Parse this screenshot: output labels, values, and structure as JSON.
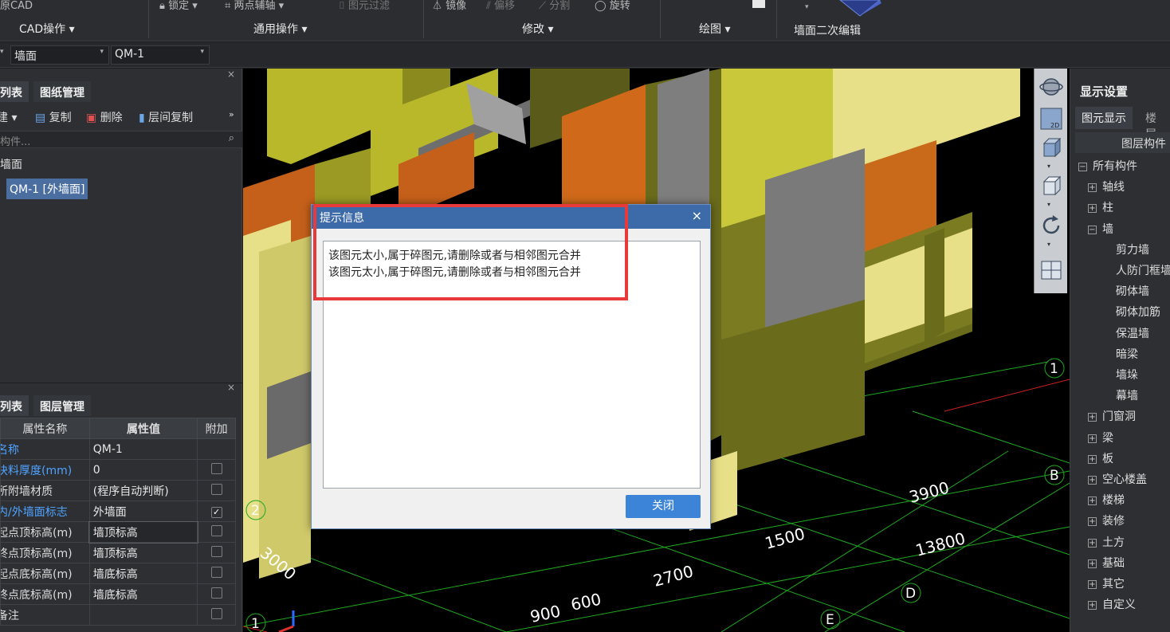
{
  "ribbon": {
    "app_fragment": "原CAD",
    "top_items": {
      "lock": "锁定",
      "two_point_axis": "两点辅轴",
      "filter": "图元过滤",
      "mirror": "镜像",
      "offset": "偏移",
      "split": "分割",
      "rotate": "旋转"
    },
    "groups": {
      "cad_ops": "CAD操作",
      "general_ops": "通用操作",
      "modify": "修改",
      "draw": "绘图",
      "wall_secondary_edit": "墙面二次编辑"
    }
  },
  "selectors": {
    "category": "墙面",
    "component": "QM-1"
  },
  "left_top_panel": {
    "tabs": {
      "list": "列表",
      "drawing_mgmt": "图纸管理"
    },
    "toolbar": {
      "new": "建",
      "copy": "复制",
      "delete": "删除",
      "floor_copy": "层间复制"
    },
    "search_placeholder": "构件...",
    "tree_root": "墙面",
    "tree_item": "QM-1 [外墙面]"
  },
  "left_bottom_panel": {
    "tabs": {
      "list": "列表",
      "layer_mgmt": "图层管理"
    },
    "headers": {
      "name": "属性名称",
      "value": "属性值",
      "extra": "附加"
    },
    "rows": [
      {
        "name": "名称",
        "value": "QM-1",
        "checked": null,
        "blue": true
      },
      {
        "name": "块料厚度(mm)",
        "value": "0",
        "checked": false,
        "blue": true
      },
      {
        "name": "所附墙材质",
        "value": "(程序自动判断)",
        "checked": false,
        "blue": false
      },
      {
        "name": "内/外墙面标志",
        "value": "外墙面",
        "checked": true,
        "blue": true
      },
      {
        "name": "起点顶标高(m)",
        "value": "墙顶标高",
        "checked": false,
        "blue": false,
        "editing": true
      },
      {
        "name": "终点顶标高(m)",
        "value": "墙顶标高",
        "checked": false,
        "blue": false
      },
      {
        "name": "起点底标高(m)",
        "value": "墙底标高",
        "checked": false,
        "blue": false
      },
      {
        "name": "终点底标高(m)",
        "value": "墙底标高",
        "checked": false,
        "blue": false
      },
      {
        "name": "备注",
        "value": "",
        "checked": false,
        "blue": false
      }
    ]
  },
  "viewport": {
    "dimensions": [
      "3000",
      "900",
      "600",
      "2700",
      "1500",
      "3900",
      "13800"
    ],
    "axis_labels": [
      "1",
      "2",
      "1",
      "B",
      "D",
      "E"
    ]
  },
  "right_panel": {
    "title": "显示设置",
    "tabs": {
      "element_display": "图元显示",
      "floor": "楼层"
    },
    "column_header": "图层构件",
    "tree": [
      {
        "label": "所有构件",
        "sign": "−",
        "level": 0
      },
      {
        "label": "轴线",
        "sign": "+",
        "level": 1
      },
      {
        "label": "柱",
        "sign": "+",
        "level": 1
      },
      {
        "label": "墙",
        "sign": "−",
        "level": 1
      },
      {
        "label": "剪力墙",
        "sign": "",
        "level": 2
      },
      {
        "label": "人防门框墙",
        "sign": "",
        "level": 2
      },
      {
        "label": "砌体墙",
        "sign": "",
        "level": 2
      },
      {
        "label": "砌体加筋",
        "sign": "",
        "level": 2
      },
      {
        "label": "保温墙",
        "sign": "",
        "level": 2
      },
      {
        "label": "暗梁",
        "sign": "",
        "level": 2
      },
      {
        "label": "墙垛",
        "sign": "",
        "level": 2
      },
      {
        "label": "幕墙",
        "sign": "",
        "level": 2
      },
      {
        "label": "门窗洞",
        "sign": "+",
        "level": 1
      },
      {
        "label": "梁",
        "sign": "+",
        "level": 1
      },
      {
        "label": "板",
        "sign": "+",
        "level": 1
      },
      {
        "label": "空心楼盖",
        "sign": "+",
        "level": 1
      },
      {
        "label": "楼梯",
        "sign": "+",
        "level": 1
      },
      {
        "label": "装修",
        "sign": "+",
        "level": 1
      },
      {
        "label": "土方",
        "sign": "+",
        "level": 1
      },
      {
        "label": "基础",
        "sign": "+",
        "level": 1
      },
      {
        "label": "其它",
        "sign": "+",
        "level": 1
      },
      {
        "label": "自定义",
        "sign": "+",
        "level": 1
      }
    ]
  },
  "dialog": {
    "title": "提示信息",
    "messages": [
      "该图元太小,属于碎图元,请删除或者与相邻图元合并",
      "该图元太小,属于碎图元,请删除或者与相邻图元合并"
    ],
    "close_button": "关闭"
  },
  "colors": {
    "dialog_title": "#3d6aa8",
    "highlight": "#e83a3a",
    "button": "#3b84d8",
    "grid_line": "#1fa81f"
  }
}
